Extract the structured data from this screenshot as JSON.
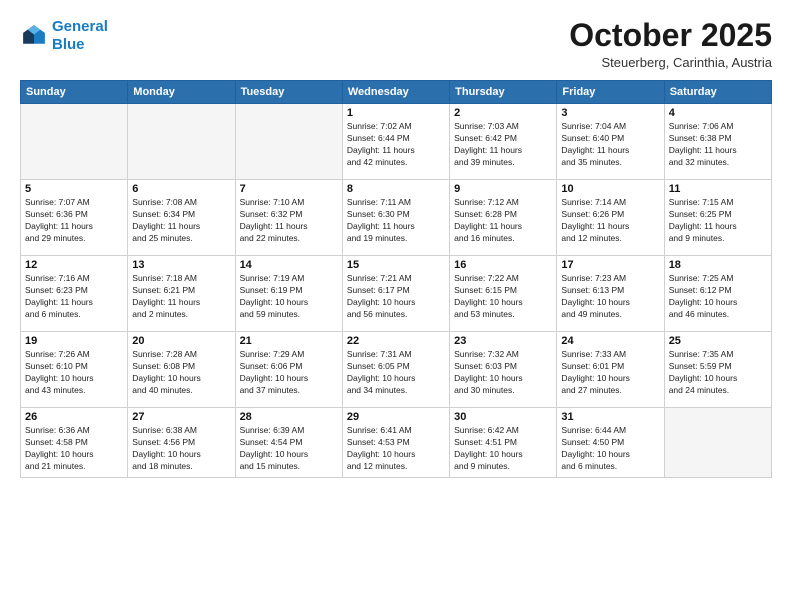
{
  "header": {
    "logo_line1": "General",
    "logo_line2": "Blue",
    "month_title": "October 2025",
    "subtitle": "Steuerberg, Carinthia, Austria"
  },
  "weekdays": [
    "Sunday",
    "Monday",
    "Tuesday",
    "Wednesday",
    "Thursday",
    "Friday",
    "Saturday"
  ],
  "weeks": [
    [
      {
        "day": "",
        "info": ""
      },
      {
        "day": "",
        "info": ""
      },
      {
        "day": "",
        "info": ""
      },
      {
        "day": "1",
        "info": "Sunrise: 7:02 AM\nSunset: 6:44 PM\nDaylight: 11 hours\nand 42 minutes."
      },
      {
        "day": "2",
        "info": "Sunrise: 7:03 AM\nSunset: 6:42 PM\nDaylight: 11 hours\nand 39 minutes."
      },
      {
        "day": "3",
        "info": "Sunrise: 7:04 AM\nSunset: 6:40 PM\nDaylight: 11 hours\nand 35 minutes."
      },
      {
        "day": "4",
        "info": "Sunrise: 7:06 AM\nSunset: 6:38 PM\nDaylight: 11 hours\nand 32 minutes."
      }
    ],
    [
      {
        "day": "5",
        "info": "Sunrise: 7:07 AM\nSunset: 6:36 PM\nDaylight: 11 hours\nand 29 minutes."
      },
      {
        "day": "6",
        "info": "Sunrise: 7:08 AM\nSunset: 6:34 PM\nDaylight: 11 hours\nand 25 minutes."
      },
      {
        "day": "7",
        "info": "Sunrise: 7:10 AM\nSunset: 6:32 PM\nDaylight: 11 hours\nand 22 minutes."
      },
      {
        "day": "8",
        "info": "Sunrise: 7:11 AM\nSunset: 6:30 PM\nDaylight: 11 hours\nand 19 minutes."
      },
      {
        "day": "9",
        "info": "Sunrise: 7:12 AM\nSunset: 6:28 PM\nDaylight: 11 hours\nand 16 minutes."
      },
      {
        "day": "10",
        "info": "Sunrise: 7:14 AM\nSunset: 6:26 PM\nDaylight: 11 hours\nand 12 minutes."
      },
      {
        "day": "11",
        "info": "Sunrise: 7:15 AM\nSunset: 6:25 PM\nDaylight: 11 hours\nand 9 minutes."
      }
    ],
    [
      {
        "day": "12",
        "info": "Sunrise: 7:16 AM\nSunset: 6:23 PM\nDaylight: 11 hours\nand 6 minutes."
      },
      {
        "day": "13",
        "info": "Sunrise: 7:18 AM\nSunset: 6:21 PM\nDaylight: 11 hours\nand 2 minutes."
      },
      {
        "day": "14",
        "info": "Sunrise: 7:19 AM\nSunset: 6:19 PM\nDaylight: 10 hours\nand 59 minutes."
      },
      {
        "day": "15",
        "info": "Sunrise: 7:21 AM\nSunset: 6:17 PM\nDaylight: 10 hours\nand 56 minutes."
      },
      {
        "day": "16",
        "info": "Sunrise: 7:22 AM\nSunset: 6:15 PM\nDaylight: 10 hours\nand 53 minutes."
      },
      {
        "day": "17",
        "info": "Sunrise: 7:23 AM\nSunset: 6:13 PM\nDaylight: 10 hours\nand 49 minutes."
      },
      {
        "day": "18",
        "info": "Sunrise: 7:25 AM\nSunset: 6:12 PM\nDaylight: 10 hours\nand 46 minutes."
      }
    ],
    [
      {
        "day": "19",
        "info": "Sunrise: 7:26 AM\nSunset: 6:10 PM\nDaylight: 10 hours\nand 43 minutes."
      },
      {
        "day": "20",
        "info": "Sunrise: 7:28 AM\nSunset: 6:08 PM\nDaylight: 10 hours\nand 40 minutes."
      },
      {
        "day": "21",
        "info": "Sunrise: 7:29 AM\nSunset: 6:06 PM\nDaylight: 10 hours\nand 37 minutes."
      },
      {
        "day": "22",
        "info": "Sunrise: 7:31 AM\nSunset: 6:05 PM\nDaylight: 10 hours\nand 34 minutes."
      },
      {
        "day": "23",
        "info": "Sunrise: 7:32 AM\nSunset: 6:03 PM\nDaylight: 10 hours\nand 30 minutes."
      },
      {
        "day": "24",
        "info": "Sunrise: 7:33 AM\nSunset: 6:01 PM\nDaylight: 10 hours\nand 27 minutes."
      },
      {
        "day": "25",
        "info": "Sunrise: 7:35 AM\nSunset: 5:59 PM\nDaylight: 10 hours\nand 24 minutes."
      }
    ],
    [
      {
        "day": "26",
        "info": "Sunrise: 6:36 AM\nSunset: 4:58 PM\nDaylight: 10 hours\nand 21 minutes."
      },
      {
        "day": "27",
        "info": "Sunrise: 6:38 AM\nSunset: 4:56 PM\nDaylight: 10 hours\nand 18 minutes."
      },
      {
        "day": "28",
        "info": "Sunrise: 6:39 AM\nSunset: 4:54 PM\nDaylight: 10 hours\nand 15 minutes."
      },
      {
        "day": "29",
        "info": "Sunrise: 6:41 AM\nSunset: 4:53 PM\nDaylight: 10 hours\nand 12 minutes."
      },
      {
        "day": "30",
        "info": "Sunrise: 6:42 AM\nSunset: 4:51 PM\nDaylight: 10 hours\nand 9 minutes."
      },
      {
        "day": "31",
        "info": "Sunrise: 6:44 AM\nSunset: 4:50 PM\nDaylight: 10 hours\nand 6 minutes."
      },
      {
        "day": "",
        "info": ""
      }
    ]
  ]
}
